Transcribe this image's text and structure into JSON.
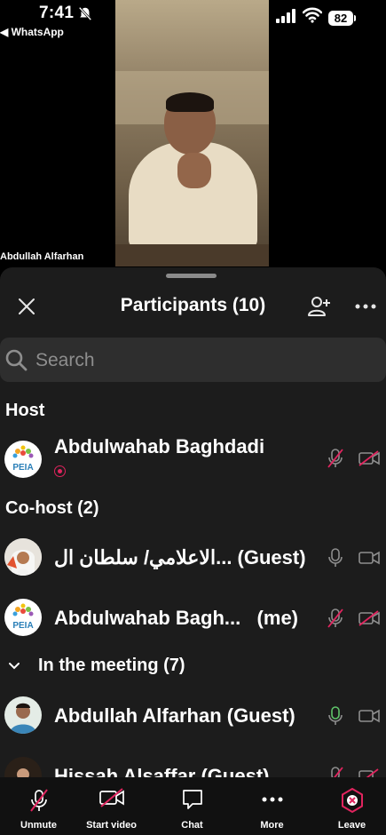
{
  "status_bar": {
    "time": "7:41",
    "back_app": "◀ WhatsApp",
    "battery": "82"
  },
  "video": {
    "speaker_label": "Abdullah Alfarhan"
  },
  "header": {
    "title": "Participants (10)"
  },
  "search": {
    "placeholder": "Search"
  },
  "sections": {
    "host": "Host",
    "cohost": "Co-host (2)",
    "meeting": "In the meeting (7)"
  },
  "participants": [
    {
      "name": "Abdulwahab Baghdadi",
      "mic": "muted",
      "video": "off",
      "avatar": "peia-logo"
    },
    {
      "name": "الاعلامي/ سلطان ال...  (Guest)",
      "mic": "on",
      "video": "on",
      "avatar": "photo"
    },
    {
      "name": "Abdulwahab Bagh...   (me)",
      "mic": "muted",
      "video": "off",
      "avatar": "peia-logo"
    },
    {
      "name": "Abdullah Alfarhan (Guest)",
      "mic": "active",
      "video": "on",
      "avatar": "photo"
    },
    {
      "name": "Hissah Alsaffar (Guest)",
      "mic": "muted",
      "video": "off",
      "avatar": "photo"
    }
  ],
  "toolbar": {
    "unmute": "Unmute",
    "start_video": "Start video",
    "chat": "Chat",
    "more": "More",
    "leave": "Leave"
  },
  "colors": {
    "accent_red": "#e0245e",
    "active_mic": "#5fc46a",
    "sheet_bg": "#1c1c1c"
  }
}
